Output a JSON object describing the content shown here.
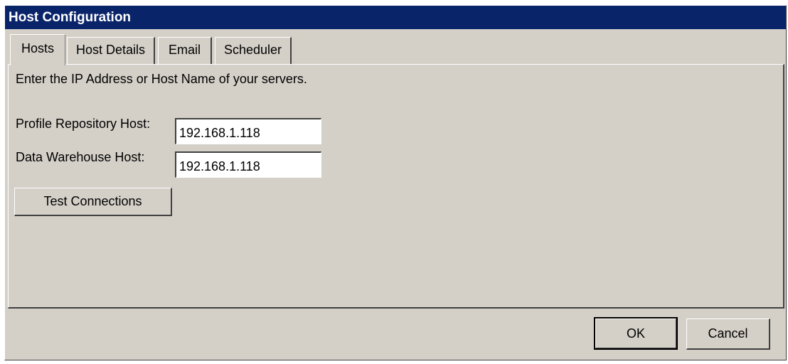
{
  "window": {
    "title": "Host Configuration"
  },
  "tabs": [
    {
      "label": "Hosts",
      "active": true
    },
    {
      "label": "Host Details",
      "active": false
    },
    {
      "label": "Email",
      "active": false
    },
    {
      "label": "Scheduler",
      "active": false
    }
  ],
  "hosts": {
    "instruction": "Enter the IP Address or Host Name of your servers.",
    "profile_repository": {
      "label": "Profile Repository Host:",
      "value": "192.168.1.118"
    },
    "data_warehouse": {
      "label": "Data Warehouse Host:",
      "value": "192.168.1.118"
    },
    "test_button_label": "Test Connections"
  },
  "footer": {
    "ok_label": "OK",
    "cancel_label": "Cancel"
  }
}
